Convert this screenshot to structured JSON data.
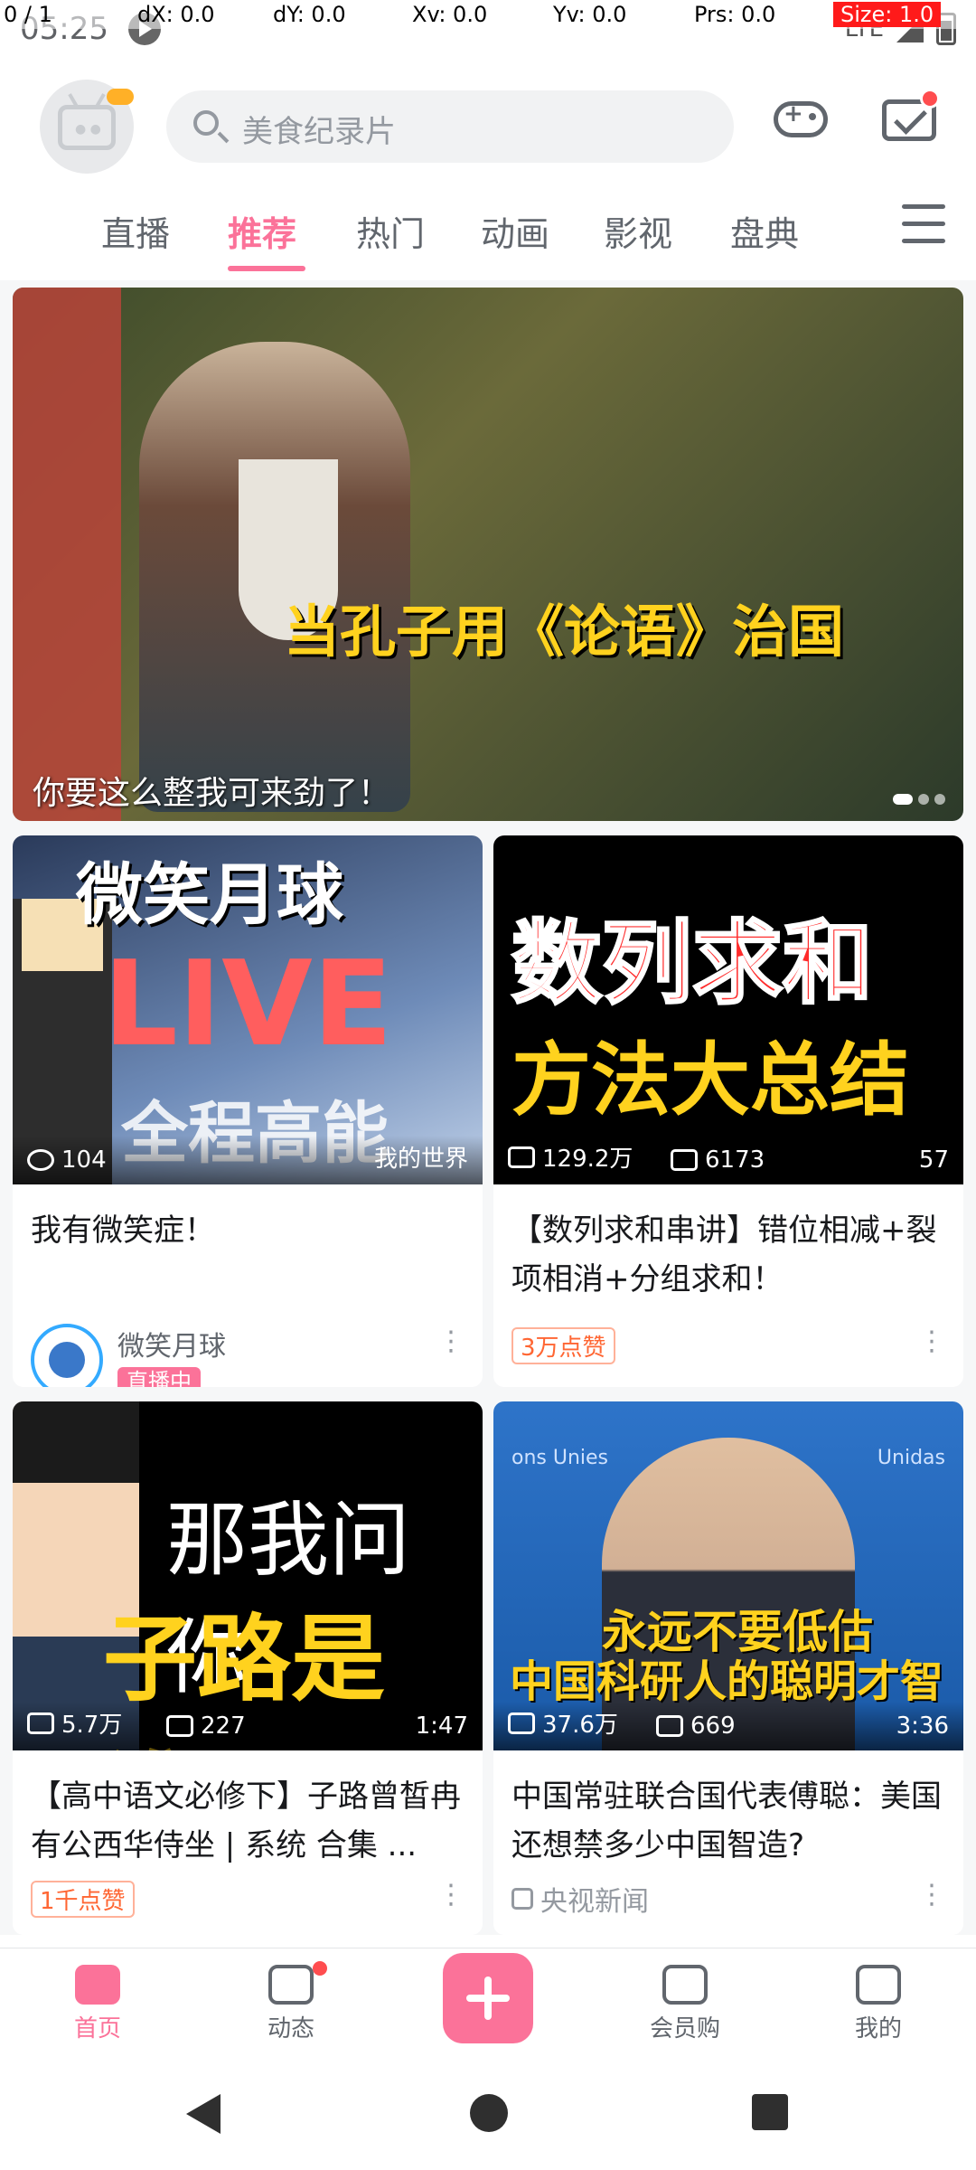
{
  "status_bar": {
    "time": "05:25",
    "network": "LTE"
  },
  "debug": {
    "pointer": "0 / 1",
    "dx": "dX: 0.0",
    "dy": "dY: 0.0",
    "xv": "Xv: 0.0",
    "yv": "Yv: 0.0",
    "prs": "Prs: 0.0",
    "size": "Size: 1.0"
  },
  "header": {
    "search_placeholder": "美食纪录片"
  },
  "tabs": [
    {
      "label": "直播"
    },
    {
      "label": "推荐"
    },
    {
      "label": "热门"
    },
    {
      "label": "动画"
    },
    {
      "label": "影视"
    },
    {
      "label": "盘典"
    }
  ],
  "banner": {
    "headline": "当孔子用《论语》治国",
    "caption": "你要这么整我可来劲了！"
  },
  "cards": [
    {
      "thumb_line1": "微笑月球",
      "thumb_line2": "LIVE",
      "thumb_line3": "全程高能",
      "views": "104",
      "duration": "我的世界",
      "title": "我有微笑症！",
      "uploader": "微笑月球",
      "live_tag": "直播中"
    },
    {
      "thumb_line1": "数列求和",
      "thumb_line2": "方法大总结",
      "views": "129.2万",
      "danmaku": "6173",
      "duration": "57",
      "title": "【数列求和串讲】错位相减+裂项相消+分组求和！",
      "likes": "3万点赞"
    },
    {
      "thumb_line1": "那我问你",
      "thumb_line2": "子路是谁？",
      "views": "5.7万",
      "danmaku": "227",
      "duration": "1:47",
      "title": "【高中语文必修下】子路曾皙冉有公西华侍坐 | 系统 合集 ...",
      "likes": "1千点赞"
    },
    {
      "thumb_label_left": "ons Unies",
      "thumb_label_right": "Unidas",
      "thumb_line1": "永远不要低估",
      "thumb_line2": "中国科研人的聪明才智",
      "views": "37.6万",
      "danmaku": "669",
      "duration": "3:36",
      "title": "中国常驻联合国代表傅聪：美国还想禁多少中国智造?",
      "uploader": "央视新闻"
    }
  ],
  "bottom_nav": [
    {
      "label": "首页",
      "icon": "home-icon"
    },
    {
      "label": "动态",
      "icon": "dynamic-icon"
    },
    {
      "label": "",
      "icon": "publish-icon"
    },
    {
      "label": "会员购",
      "icon": "shop-icon"
    },
    {
      "label": "我的",
      "icon": "profile-icon"
    }
  ],
  "colors": {
    "accent": "#fb7299",
    "text": "#18191c",
    "secondary": "#9499a0"
  }
}
